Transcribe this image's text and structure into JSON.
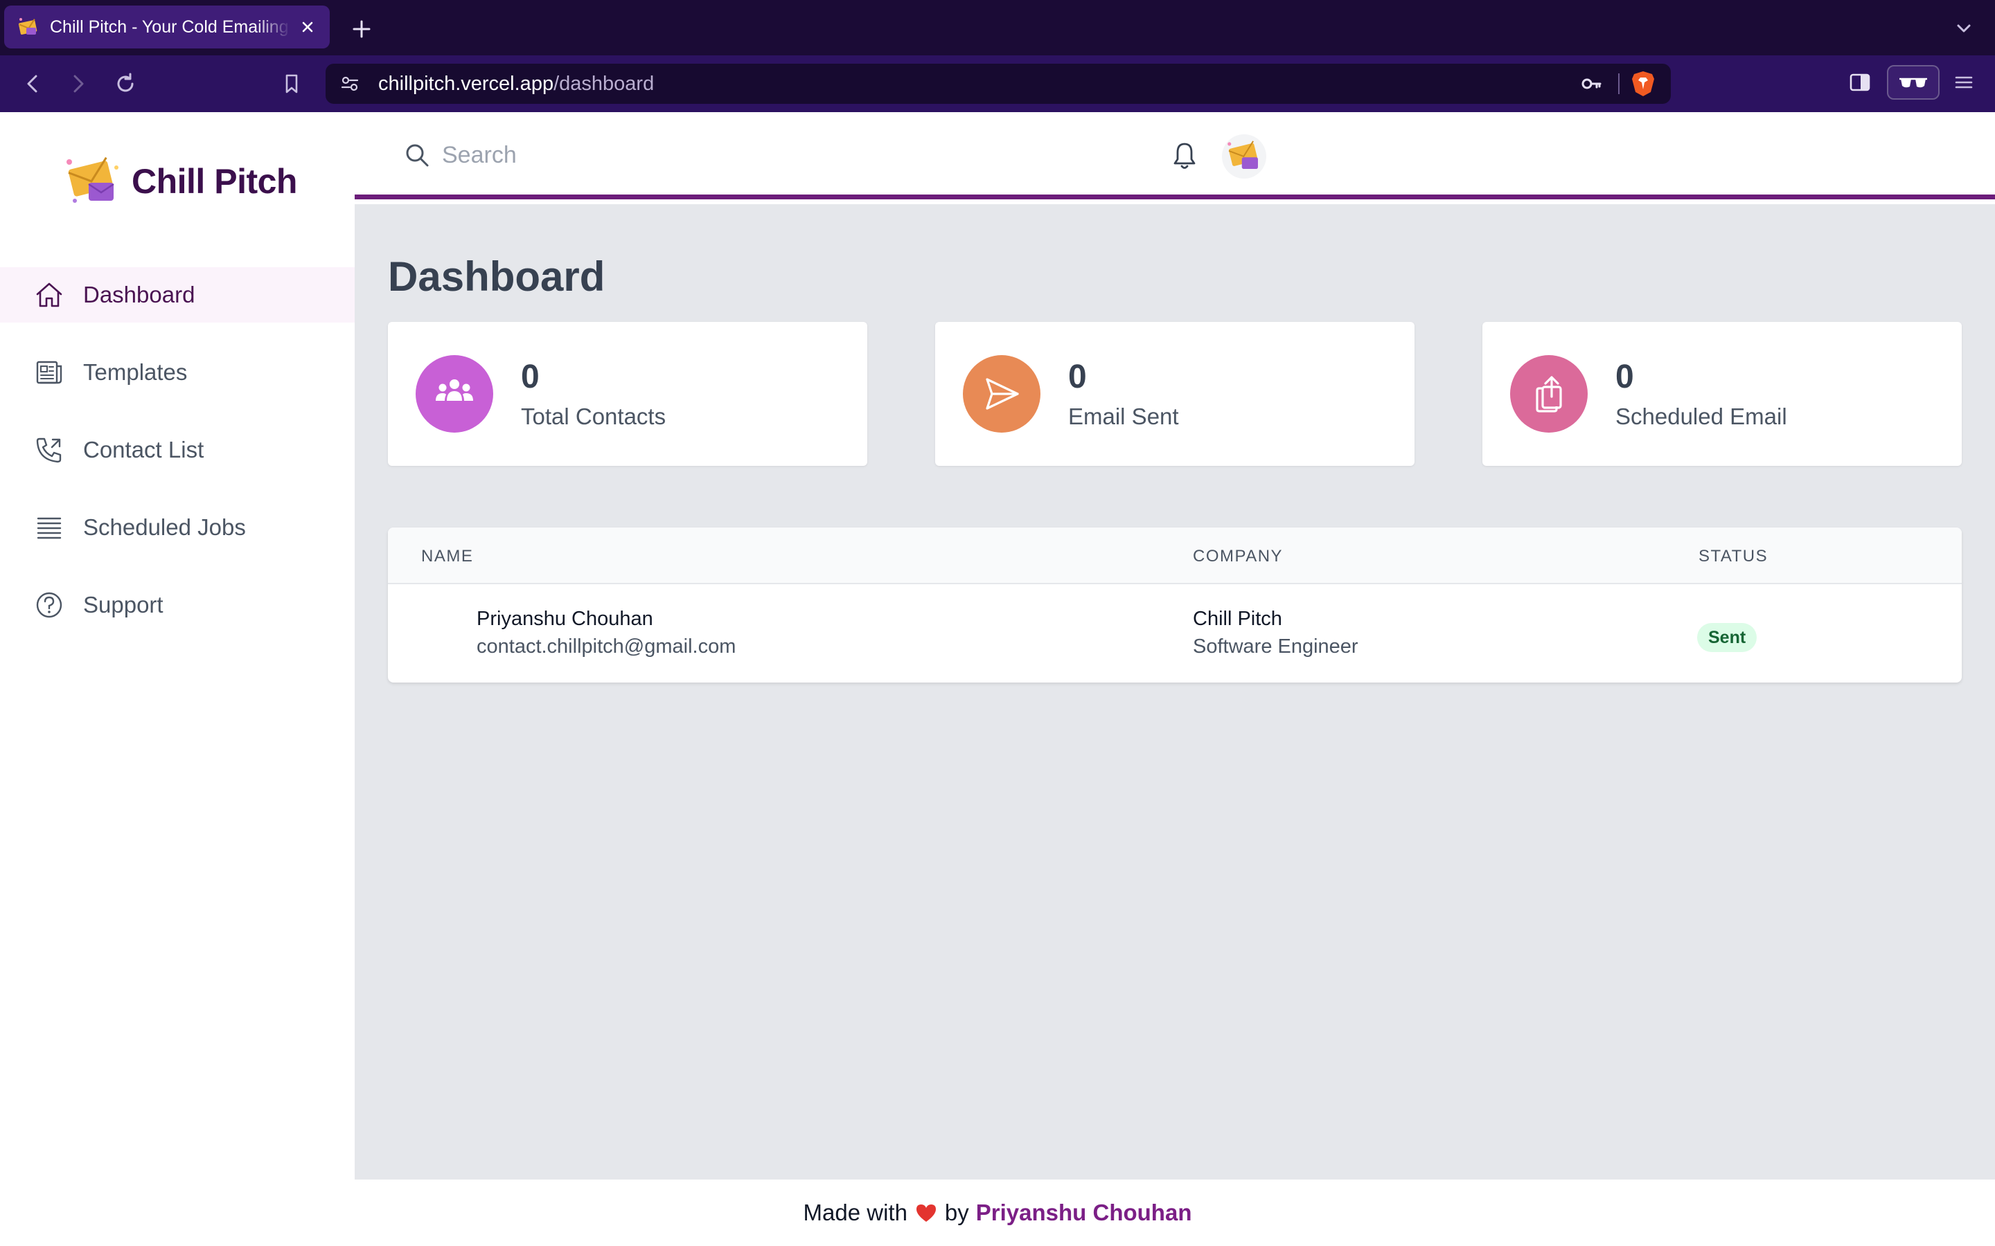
{
  "browser": {
    "tab_title": "Chill Pitch - Your Cold Emailing Companion",
    "url_host": "chillpitch.vercel.app",
    "url_path": "/dashboard"
  },
  "brand": {
    "name": "Chill Pitch"
  },
  "sidebar": {
    "items": [
      {
        "label": "Dashboard",
        "icon": "home-icon",
        "active": true
      },
      {
        "label": "Templates",
        "icon": "newspaper-icon",
        "active": false
      },
      {
        "label": "Contact List",
        "icon": "phone-icon",
        "active": false
      },
      {
        "label": "Scheduled Jobs",
        "icon": "list-icon",
        "active": false
      },
      {
        "label": "Support",
        "icon": "help-circle-icon",
        "active": false
      }
    ]
  },
  "header": {
    "search_placeholder": "Search"
  },
  "main": {
    "title": "Dashboard",
    "stats": [
      {
        "value": "0",
        "label": "Total Contacts",
        "icon": "users-icon",
        "color": "#c860d6"
      },
      {
        "value": "0",
        "label": "Email Sent",
        "icon": "send-icon",
        "color": "#e88a55"
      },
      {
        "value": "0",
        "label": "Scheduled Email",
        "icon": "share-icon",
        "color": "#db6a9a"
      }
    ],
    "table": {
      "headers": [
        "NAME",
        "COMPANY",
        "STATUS"
      ],
      "rows": [
        {
          "name": "Priyanshu Chouhan",
          "email": "contact.chillpitch@gmail.com",
          "company": "Chill Pitch",
          "role": "Software Engineer",
          "status": "Sent"
        }
      ]
    }
  },
  "footer": {
    "prefix": "Made with",
    "by": "by",
    "author": "Priyanshu Chouhan"
  },
  "colors": {
    "accent": "#6c1d7a",
    "brand_text": "#3b0f4c",
    "status_sent_bg": "#dcfce7",
    "status_sent_text": "#166534"
  }
}
